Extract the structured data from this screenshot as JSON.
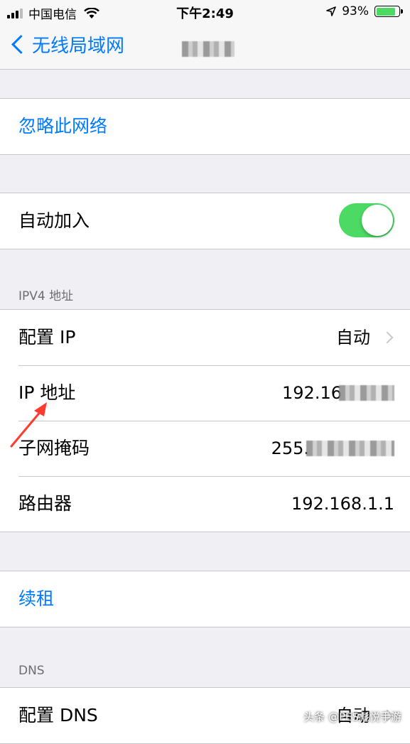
{
  "status_bar": {
    "carrier": "中国电信",
    "time": "下午2:49",
    "battery_percent": "93%",
    "battery_level": 0.93
  },
  "nav": {
    "back_label": "无线局域网"
  },
  "forget": {
    "label": "忽略此网络"
  },
  "auto_join": {
    "label": "自动加入",
    "enabled": true
  },
  "ipv4": {
    "header": "IPV4 地址",
    "configure_ip": {
      "label": "配置 IP",
      "value": "自动"
    },
    "ip_address": {
      "label": "IP 地址",
      "value": "192.16"
    },
    "subnet_mask": {
      "label": "子网掩码",
      "value": "255."
    },
    "router": {
      "label": "路由器",
      "value": "192.168.1.1"
    }
  },
  "renew": {
    "label": "续租"
  },
  "dns": {
    "header": "DNS",
    "configure_dns": {
      "label": "配置 DNS",
      "value": "自动"
    }
  },
  "watermark": "头条 @PES彪悦手游",
  "colors": {
    "accent": "#007aff",
    "toggle_on": "#4cd964",
    "background": "#efeff4",
    "annotation_arrow": "#ff3b30"
  }
}
